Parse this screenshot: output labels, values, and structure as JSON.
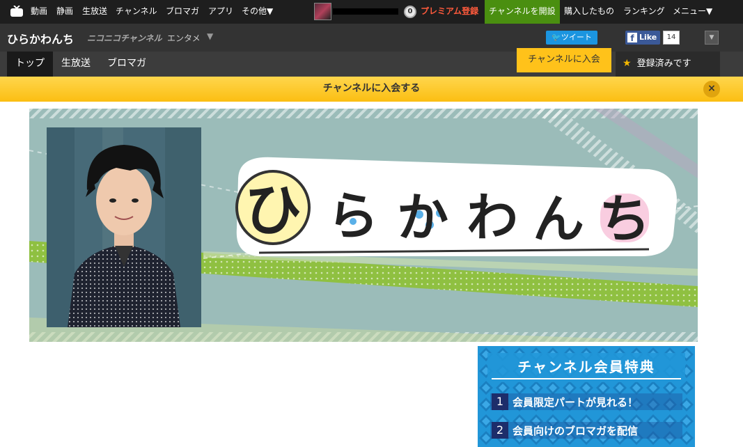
{
  "global_nav": {
    "items": [
      "動画",
      "静画",
      "生放送",
      "チャンネル",
      "ブロマガ",
      "アプリ",
      "その他▼"
    ],
    "points": "0",
    "premium": "プレミアム登録",
    "open_channel": "チャンネルを開設",
    "purchased": "購入したもの",
    "ranking": "ランキング",
    "menu": "メニュー▼"
  },
  "channel": {
    "title": "ひらかわんち",
    "brand": "ニコニコチャンネル",
    "category": "エンタメ",
    "category_arrow": "▼",
    "tweet": "ツイート",
    "like": "Like",
    "like_count": "14"
  },
  "tabs": [
    "トップ",
    "生放送",
    "ブロマガ"
  ],
  "join_tab": "チャンネルに入会",
  "registered": "登録済みです",
  "join_banner": {
    "text": "チャンネルに入会する",
    "close": "×"
  },
  "banner": {
    "logo_chars": [
      "ひ",
      "ら",
      "か",
      "わ",
      "ん",
      "ち"
    ]
  },
  "benefits": {
    "title": "チャンネル会員特典",
    "items": [
      {
        "num": "1",
        "text": "会員限定パートが見れる！"
      },
      {
        "num": "2",
        "text": "会員向けのブロマガを配信"
      }
    ]
  },
  "colors": {
    "join_yellow": "#ffc21a",
    "premium_red": "#ff5a3c",
    "open_channel_green": "#4a8f10",
    "twitter_blue": "#1b95e0",
    "facebook_blue": "#3b5998",
    "benefit_blue": "#2196d8"
  }
}
